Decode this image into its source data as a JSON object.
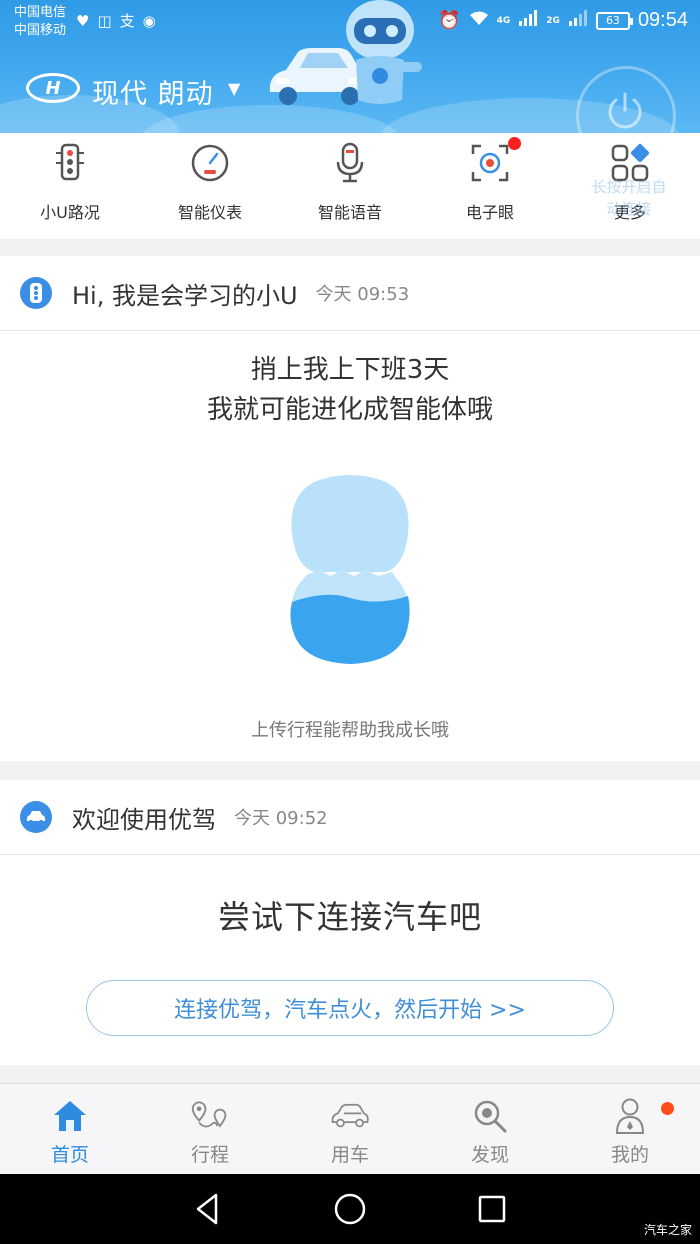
{
  "status_bar": {
    "carrier_1": "中国电信",
    "carrier_2": "中国移动",
    "network_1": "4G",
    "network_2": "2G",
    "battery": "63",
    "time": "09:54"
  },
  "header": {
    "brand_logo_text": "H",
    "car_name": "现代 朗动",
    "power_hint": "长按开启自动连接"
  },
  "quickbar": {
    "items": [
      {
        "label": "小U路况",
        "icon": "traffic-light-icon"
      },
      {
        "label": "智能仪表",
        "icon": "gauge-icon"
      },
      {
        "label": "智能语音",
        "icon": "microphone-icon"
      },
      {
        "label": "电子眼",
        "icon": "camera-icon"
      },
      {
        "label": "更多",
        "icon": "grid-icon"
      }
    ]
  },
  "card_learn": {
    "title": "Hi, 我是会学习的小U",
    "time": "今天 09:53",
    "line_1": "捎上我上下班3天",
    "line_2": "我就可能进化成智能体哦",
    "footer": "上传行程能帮助我成长哦"
  },
  "card_welcome": {
    "title": "欢迎使用优驾",
    "time": "今天 09:52",
    "headline": "尝试下连接汽车吧",
    "button": "连接优驾，汽车点火，然后开始 >>"
  },
  "tabbar": {
    "tabs": [
      {
        "label": "首页",
        "icon": "home-icon"
      },
      {
        "label": "行程",
        "icon": "route-icon"
      },
      {
        "label": "用车",
        "icon": "car-icon"
      },
      {
        "label": "发现",
        "icon": "discover-icon"
      },
      {
        "label": "我的",
        "icon": "profile-icon"
      }
    ]
  },
  "watermark": "汽车之家",
  "colors": {
    "header_blue": "#3ba3eb",
    "accent": "#2f8be0",
    "red_dot": "#ff1f1f"
  }
}
